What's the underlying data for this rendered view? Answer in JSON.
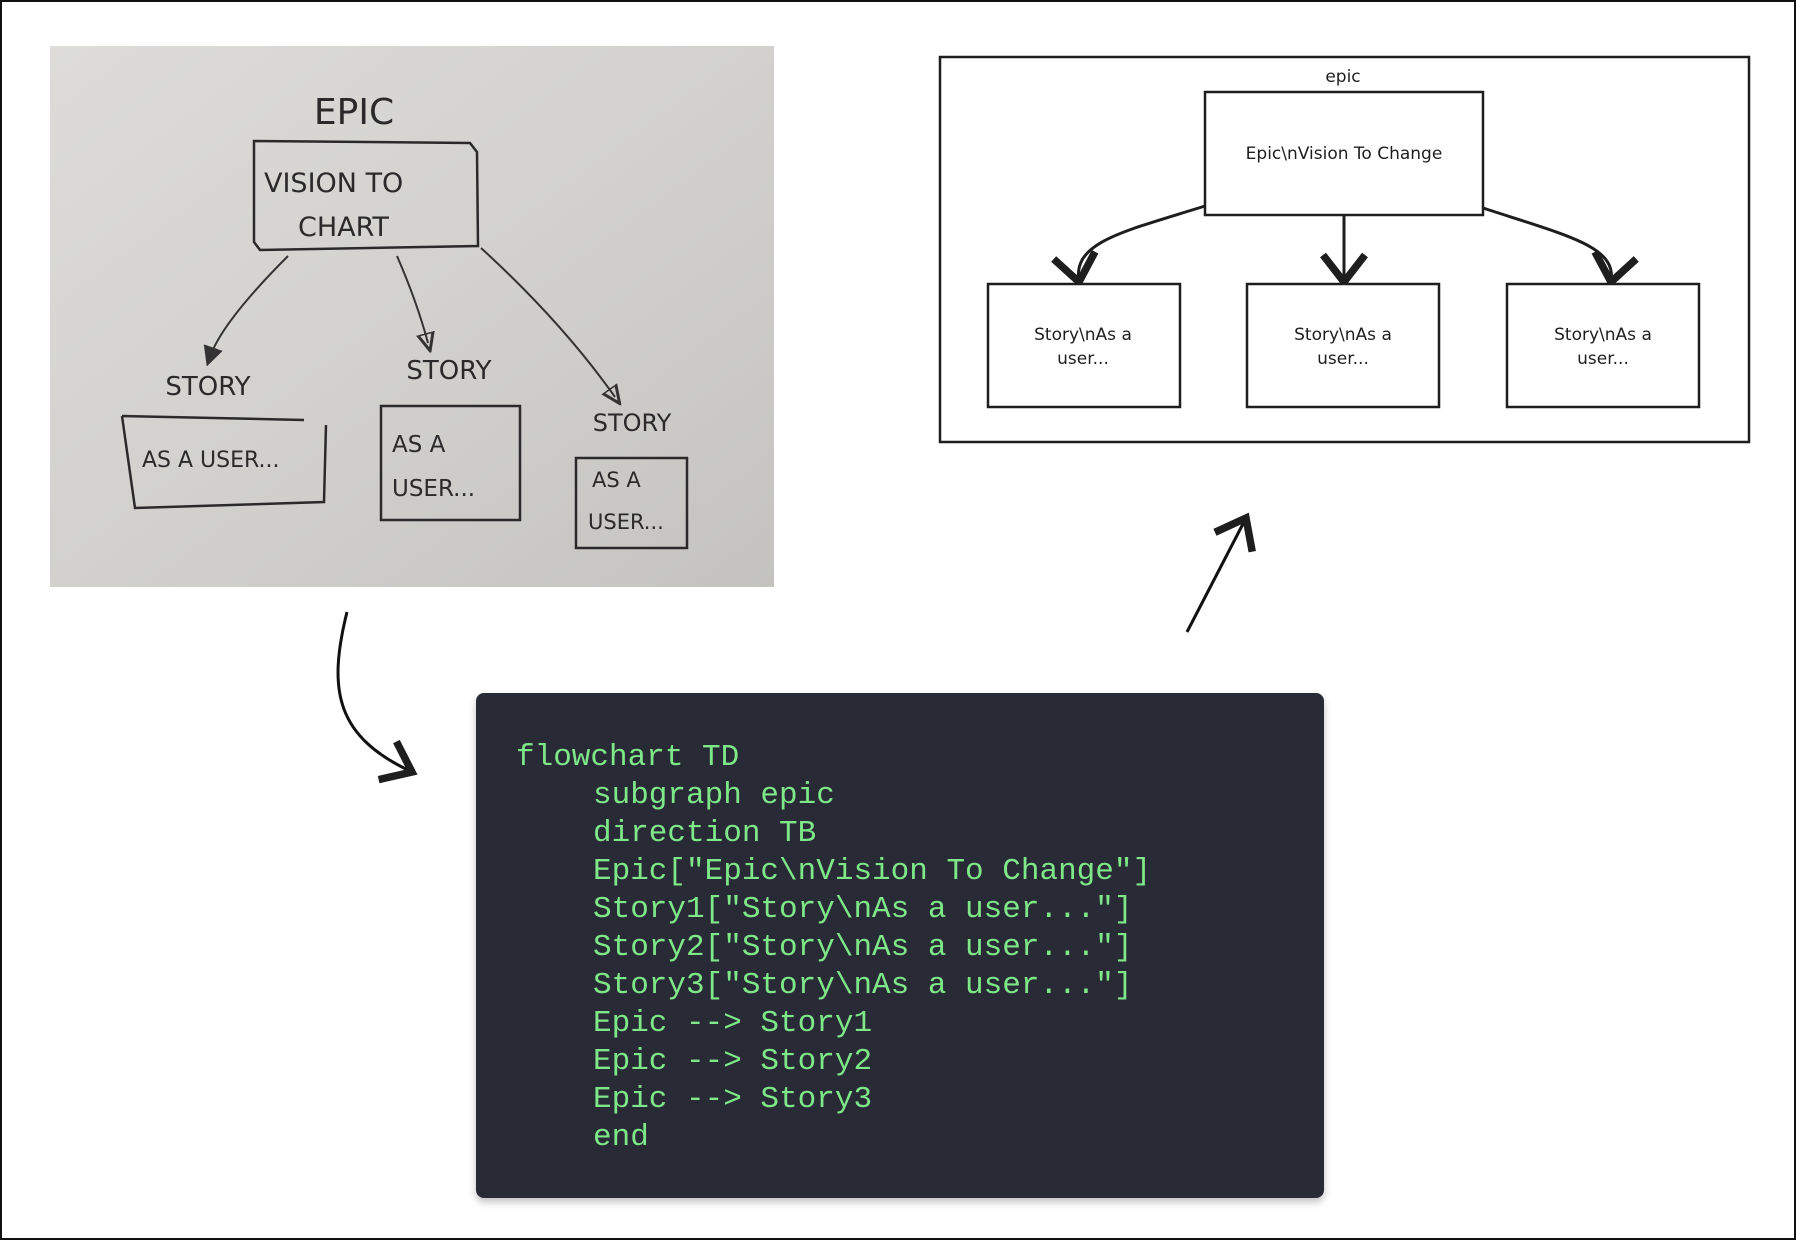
{
  "photo": {
    "title": "EPIC",
    "epic_box": [
      "VISION TO",
      "CHART"
    ],
    "stories": [
      {
        "label": "STORY",
        "lines": [
          "AS A USER..."
        ]
      },
      {
        "label": "STORY",
        "lines": [
          "AS A",
          "USER..."
        ]
      },
      {
        "label": "STORY",
        "lines": [
          "AS A",
          "USER..."
        ]
      }
    ]
  },
  "diagram": {
    "subgraph_label": "epic",
    "epic_node": "Epic\\nVision To Change",
    "story_nodes": [
      [
        "Story\\nAs a",
        "user..."
      ],
      [
        "Story\\nAs a",
        "user..."
      ],
      [
        "Story\\nAs a",
        "user..."
      ]
    ]
  },
  "code": {
    "lines": [
      "flowchart TD",
      "subgraph epic",
      "direction TB",
      "Epic[\"Epic\\nVision To Change\"]",
      "Story1[\"Story\\nAs a user...\"]",
      "Story2[\"Story\\nAs a user...\"]",
      "Story3[\"Story\\nAs a user...\"]",
      "Epic --> Story1",
      "Epic --> Story2",
      "Epic --> Story3",
      "end"
    ]
  },
  "colors": {
    "code_bg": "#282a36",
    "code_text": "#7ee787",
    "photo_bg": "#cfcecb"
  }
}
